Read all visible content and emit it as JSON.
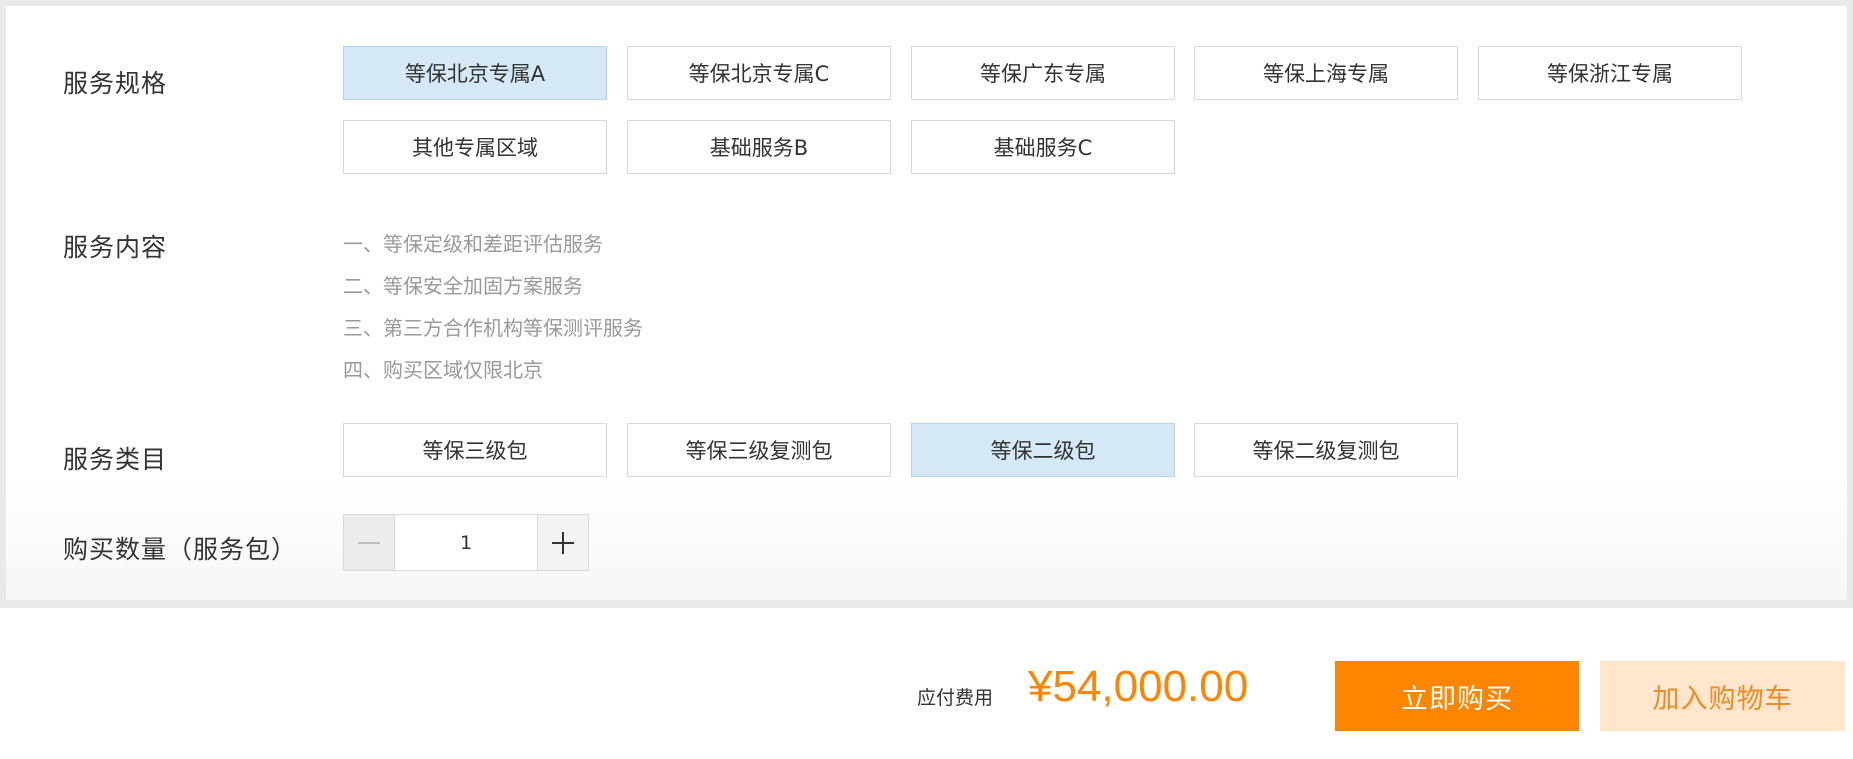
{
  "spec": {
    "label": "服务规格",
    "options": [
      "等保北京专属A",
      "等保北京专属C",
      "等保广东专属",
      "等保上海专属",
      "等保浙江专属",
      "其他专属区域",
      "基础服务B",
      "基础服务C"
    ],
    "selected": "等保北京专属A"
  },
  "content": {
    "label": "服务内容",
    "lines": [
      "一、等保定级和差距评估服务",
      "二、等保安全加固方案服务",
      "三、第三方合作机构等保测评服务",
      "四、购买区域仅限北京"
    ]
  },
  "category": {
    "label": "服务类目",
    "options": [
      "等保三级包",
      "等保三级复测包",
      "等保二级包",
      "等保二级复测包"
    ],
    "selected": "等保二级包"
  },
  "quantity": {
    "label": "购买数量（服务包）",
    "value": "1",
    "minus_icon": "minus-icon",
    "plus_icon": "plus-icon"
  },
  "footer": {
    "price_label": "应付费用",
    "price_value": "¥54,000.00",
    "buy_label": "立即购买",
    "cart_label": "加入购物车"
  },
  "colors": {
    "accent": "#ff8400",
    "selected_bg": "#d4e8f6",
    "cart_bg": "#ffe6cc"
  }
}
